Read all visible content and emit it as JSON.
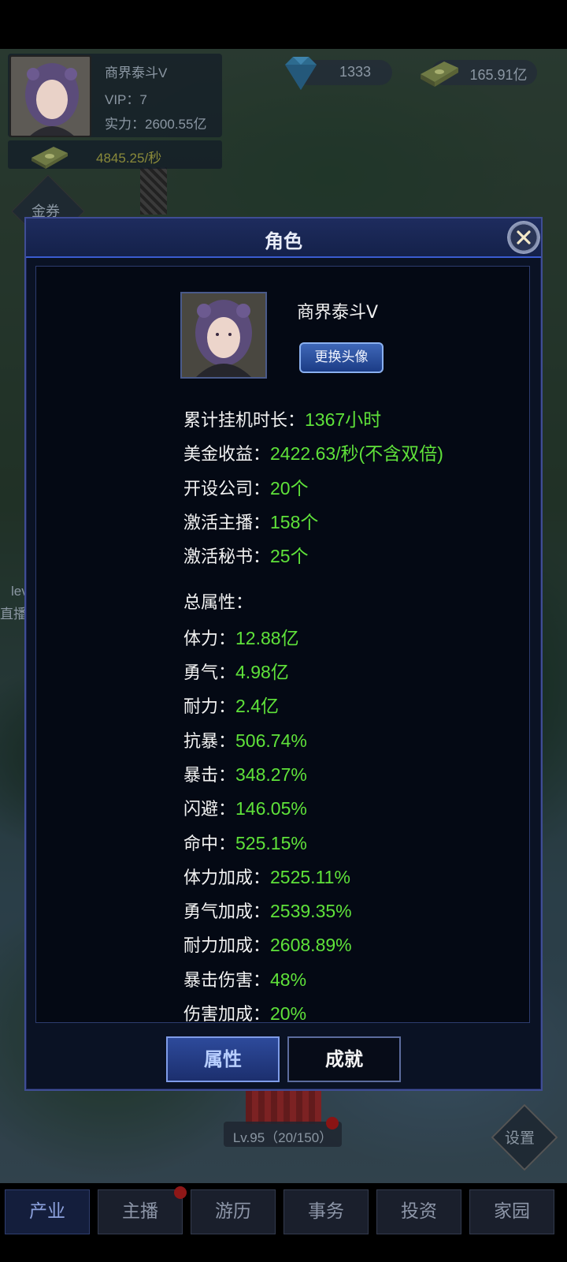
{
  "hud": {
    "player_name": "商界泰斗V",
    "vip": "VIP：7",
    "power": "实力：2600.55亿",
    "income_rate": "4845.25/秒",
    "diamonds": "1333",
    "cash": "165.91亿",
    "side_label": "金券",
    "left_label_1": "lev",
    "left_label_2": "直播",
    "level": "Lv.95（20/150）",
    "settings": "设置"
  },
  "dialog": {
    "title": "角色",
    "profile_name": "商界泰斗V",
    "change_avatar": "更换头像",
    "summary": [
      {
        "label": "累计挂机时长：",
        "value": "1367小时"
      },
      {
        "label": "美金收益：",
        "value": "2422.63/秒(不含双倍)"
      },
      {
        "label": "开设公司：",
        "value": "20个"
      },
      {
        "label": "激活主播：",
        "value": "158个"
      },
      {
        "label": "激活秘书：",
        "value": "25个"
      }
    ],
    "attributes_header": "总属性：",
    "attributes": [
      {
        "label": "体力：",
        "value": "12.88亿"
      },
      {
        "label": "勇气：",
        "value": "4.98亿"
      },
      {
        "label": "耐力：",
        "value": "2.4亿"
      },
      {
        "label": "抗暴：",
        "value": "506.74%"
      },
      {
        "label": "暴击：",
        "value": "348.27%"
      },
      {
        "label": "闪避：",
        "value": "146.05%"
      },
      {
        "label": "命中：",
        "value": "525.15%"
      },
      {
        "label": "体力加成：",
        "value": "2525.11%"
      },
      {
        "label": "勇气加成：",
        "value": "2539.35%"
      },
      {
        "label": "耐力加成：",
        "value": "2608.89%"
      },
      {
        "label": "暴击伤害：",
        "value": "48%"
      },
      {
        "label": "伤害加成：",
        "value": "20%"
      }
    ],
    "tabs": {
      "attributes": "属性",
      "achievements": "成就"
    }
  },
  "nav": [
    "产业",
    "主播",
    "游历",
    "事务",
    "投资",
    "家园"
  ],
  "colors": {
    "value_green": "#5fe23a",
    "dialog_border": "#3f4d95",
    "header_blue": "#1e2c5e"
  }
}
